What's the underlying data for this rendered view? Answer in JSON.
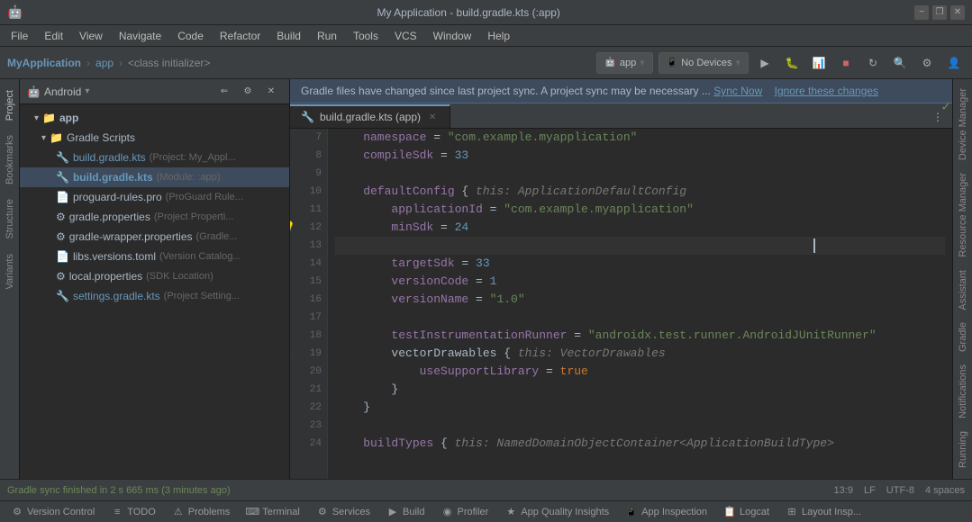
{
  "titleBar": {
    "title": "My Application - build.gradle.kts (:app)",
    "minimize": "−",
    "maximize": "❐",
    "close": "✕"
  },
  "menuBar": {
    "items": [
      "File",
      "Edit",
      "View",
      "Navigate",
      "Code",
      "Refactor",
      "Build",
      "Run",
      "Tools",
      "VCS",
      "Window",
      "Help"
    ]
  },
  "toolbar": {
    "projectName": "MyApplication",
    "module": "app",
    "classPath": "<class initializer>",
    "appLabel": "app",
    "noDevices": "No Devices",
    "chevron": "▾"
  },
  "projectPanel": {
    "title": "Project",
    "androidLabel": "Android",
    "treeItems": [
      {
        "indent": 0,
        "arrow": "▾",
        "icon": "📁",
        "label": "app",
        "sublabel": "",
        "bold": true,
        "selected": false
      },
      {
        "indent": 1,
        "arrow": "▾",
        "icon": "📁",
        "label": "Gradle Scripts",
        "sublabel": "",
        "bold": false,
        "selected": false
      },
      {
        "indent": 2,
        "arrow": "",
        "icon": "🔧",
        "label": "build.gradle.kts",
        "sublabel": "(Project: My_Appl...",
        "bold": false,
        "selected": false
      },
      {
        "indent": 2,
        "arrow": "",
        "icon": "🔧",
        "label": "build.gradle.kts",
        "sublabel": "(Module: :app)",
        "bold": false,
        "selected": true
      },
      {
        "indent": 2,
        "arrow": "",
        "icon": "📄",
        "label": "proguard-rules.pro",
        "sublabel": "(ProGuard Rule...",
        "bold": false,
        "selected": false
      },
      {
        "indent": 2,
        "arrow": "",
        "icon": "⚙️",
        "label": "gradle.properties",
        "sublabel": "(Project Properti...",
        "bold": false,
        "selected": false
      },
      {
        "indent": 2,
        "arrow": "",
        "icon": "⚙️",
        "label": "gradle-wrapper.properties",
        "sublabel": "(Gradle...",
        "bold": false,
        "selected": false
      },
      {
        "indent": 2,
        "arrow": "",
        "icon": "📄",
        "label": "libs.versions.toml",
        "sublabel": "(Version Catalog...",
        "bold": false,
        "selected": false
      },
      {
        "indent": 2,
        "arrow": "",
        "icon": "⚙️",
        "label": "local.properties",
        "sublabel": "(SDK Location)",
        "bold": false,
        "selected": false
      },
      {
        "indent": 2,
        "arrow": "",
        "icon": "🔧",
        "label": "settings.gradle.kts",
        "sublabel": "(Project Setting...",
        "bold": false,
        "selected": false
      }
    ]
  },
  "notification": {
    "text": "Gradle files have changed since last project sync. A project sync may be necessary ...",
    "syncLink": "Sync Now",
    "ignoreLink": "Ignore these changes"
  },
  "editorTab": {
    "label": "build.gradle.kts (app)",
    "icon": "🔧"
  },
  "codeLines": [
    {
      "num": 7,
      "content": "",
      "tokens": [
        {
          "t": "prop",
          "v": "    namespace"
        },
        {
          "t": "plain",
          "v": " = "
        },
        {
          "t": "str",
          "v": "\"com.example.myapplication\""
        }
      ]
    },
    {
      "num": 8,
      "content": "",
      "tokens": [
        {
          "t": "prop",
          "v": "    compileSdk"
        },
        {
          "t": "plain",
          "v": " = "
        },
        {
          "t": "num",
          "v": "33"
        }
      ]
    },
    {
      "num": 9,
      "content": "",
      "tokens": []
    },
    {
      "num": 10,
      "content": "",
      "tokens": [
        {
          "t": "prop",
          "v": "    defaultConfig"
        },
        {
          "t": "plain",
          "v": " { "
        },
        {
          "t": "hint",
          "v": "this: ApplicationDefaultConfig"
        }
      ]
    },
    {
      "num": 11,
      "content": "",
      "tokens": [
        {
          "t": "prop",
          "v": "        applicationId"
        },
        {
          "t": "plain",
          "v": " = "
        },
        {
          "t": "str",
          "v": "\"com.example.myapplication\""
        }
      ]
    },
    {
      "num": 12,
      "content": "bulb",
      "tokens": [
        {
          "t": "prop",
          "v": "        minSdk"
        },
        {
          "t": "plain",
          "v": " = "
        },
        {
          "t": "num",
          "v": "24"
        }
      ]
    },
    {
      "num": 13,
      "content": "",
      "tokens": []
    },
    {
      "num": 14,
      "content": "",
      "tokens": [
        {
          "t": "prop",
          "v": "        targetSdk"
        },
        {
          "t": "plain",
          "v": " = "
        },
        {
          "t": "num",
          "v": "33"
        }
      ]
    },
    {
      "num": 15,
      "content": "",
      "tokens": [
        {
          "t": "prop",
          "v": "        versionCode"
        },
        {
          "t": "plain",
          "v": " = "
        },
        {
          "t": "num",
          "v": "1"
        }
      ]
    },
    {
      "num": 16,
      "content": "",
      "tokens": [
        {
          "t": "prop",
          "v": "        versionName"
        },
        {
          "t": "plain",
          "v": " = "
        },
        {
          "t": "str",
          "v": "\"1.0\""
        }
      ]
    },
    {
      "num": 17,
      "content": "",
      "tokens": []
    },
    {
      "num": 18,
      "content": "",
      "tokens": [
        {
          "t": "prop",
          "v": "        testInstrumentationRunner"
        },
        {
          "t": "plain",
          "v": " = "
        },
        {
          "t": "str",
          "v": "\"androidx.test.runner.AndroidJUnitRunner\""
        }
      ]
    },
    {
      "num": 19,
      "content": "arrow",
      "tokens": [
        {
          "t": "plain",
          "v": "        vectorDrawables "
        },
        {
          "t": "plain",
          "v": "{ "
        },
        {
          "t": "hint",
          "v": "this: VectorDrawables"
        }
      ]
    },
    {
      "num": 20,
      "content": "",
      "tokens": [
        {
          "t": "prop",
          "v": "            useSupportLibrary"
        },
        {
          "t": "plain",
          "v": " = "
        },
        {
          "t": "kw",
          "v": "true"
        }
      ]
    },
    {
      "num": 21,
      "content": "",
      "tokens": [
        {
          "t": "plain",
          "v": "        }"
        }
      ]
    },
    {
      "num": 22,
      "content": "",
      "tokens": [
        {
          "t": "plain",
          "v": "    }"
        }
      ]
    },
    {
      "num": 23,
      "content": "",
      "tokens": []
    },
    {
      "num": 24,
      "content": "",
      "tokens": [
        {
          "t": "prop",
          "v": "    buildTypes"
        },
        {
          "t": "plain",
          "v": " { "
        },
        {
          "t": "hint",
          "v": "this: NamedDomainObjectContainer<ApplicationBuildType>"
        }
      ]
    }
  ],
  "rightSideTabs": [
    "Device Manager",
    "Resource Manager",
    "Assistant",
    "Gradle",
    "Notifications",
    "Running"
  ],
  "statusBar": {
    "message": "Gradle sync finished in 2 s 665 ms (3 minutes ago)",
    "position": "13:9",
    "lineEnding": "LF",
    "encoding": "UTF-8",
    "indent": "4 spaces"
  },
  "bottomTools": [
    {
      "icon": "⚙",
      "label": "Version Control"
    },
    {
      "icon": "≡",
      "label": "TODO"
    },
    {
      "icon": "⚠",
      "label": "Problems"
    },
    {
      "icon": "⌨",
      "label": "Terminal"
    },
    {
      "icon": "⚙",
      "label": "Services"
    },
    {
      "icon": "▶",
      "label": "Build"
    },
    {
      "icon": "◉",
      "label": "Profiler"
    },
    {
      "icon": "★",
      "label": "App Quality Insights"
    },
    {
      "icon": "📱",
      "label": "App Inspection"
    },
    {
      "icon": "📋",
      "label": "Logcat"
    },
    {
      "icon": "⊞",
      "label": "Layout Insp..."
    }
  ]
}
